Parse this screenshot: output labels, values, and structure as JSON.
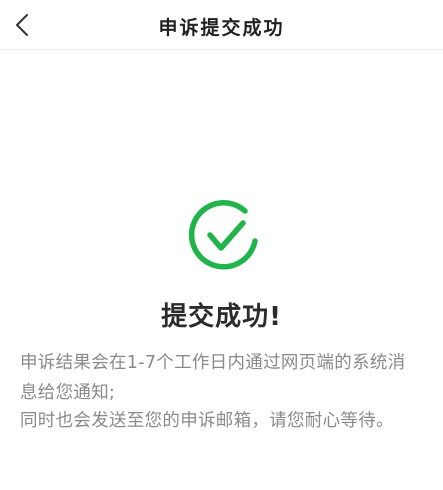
{
  "header": {
    "title": "申诉提交成功",
    "back_icon": "chevron-left-icon"
  },
  "result": {
    "icon": "check-circle-icon",
    "icon_color": "#20b44a",
    "title": "提交成功!",
    "message_line_1": "申诉结果会在1-7个工作日内通过网页端的系统消息给您通知;",
    "message_line_2": "同时也会发送至您的申诉邮箱，请您耐心等待。"
  }
}
